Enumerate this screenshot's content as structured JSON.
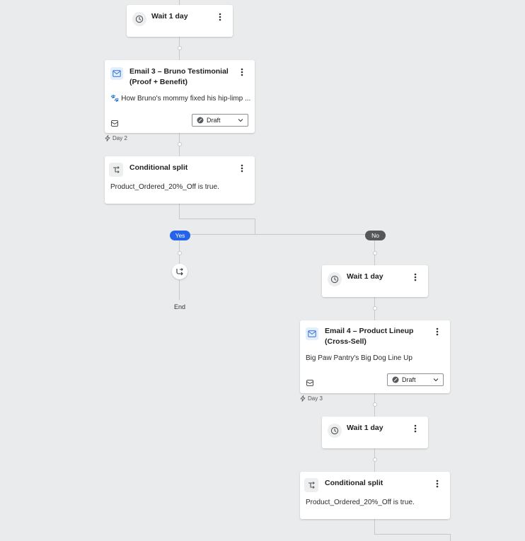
{
  "nodes": {
    "wait1": {
      "title": "Wait 1 day"
    },
    "email3": {
      "title_line1": "Email 3 – Bruno Testimonial",
      "title_line2": "(Proof + Benefit)",
      "preview": "🐾 How Bruno's mommy fixed his hip-limp ...",
      "status": "Draft",
      "day": "Day 2"
    },
    "split1": {
      "title": "Conditional split",
      "condition": "Product_Ordered_20%_Off is true."
    },
    "branch_yes": {
      "label": "Yes",
      "color": "#2563eb"
    },
    "branch_no": {
      "label": "No",
      "color": "#55585b"
    },
    "end": {
      "label": "End"
    },
    "wait2": {
      "title": "Wait 1 day"
    },
    "email4": {
      "title_line1": "Email 4 – Product Lineup",
      "title_line2": "(Cross-Sell)",
      "preview": "Big Paw Pantry's Big Dog Line Up",
      "status": "Draft",
      "day": "Day 3"
    },
    "wait3": {
      "title": "Wait 1 day"
    },
    "split2": {
      "title": "Conditional split",
      "condition": "Product_Ordered_20%_Off is true."
    }
  }
}
